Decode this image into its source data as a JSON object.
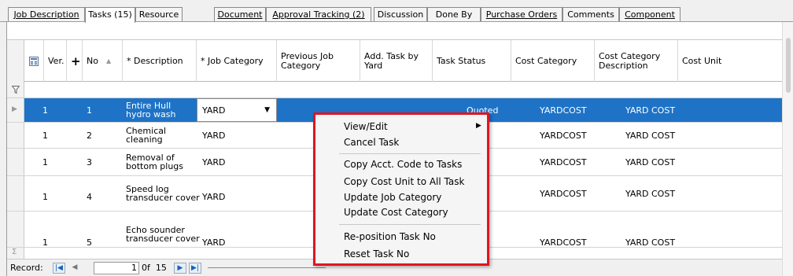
{
  "tabs": [
    {
      "label": "Job Description"
    },
    {
      "label": "Tasks (15)"
    },
    {
      "label": "Resource"
    },
    {
      "label": "Document"
    },
    {
      "label": "Approval Tracking (2)"
    },
    {
      "label": "Discussion"
    },
    {
      "label": "Done By"
    },
    {
      "label": "Purchase Orders"
    },
    {
      "label": "Comments"
    },
    {
      "label": "Component"
    }
  ],
  "grid": {
    "columns": [
      {
        "label": ""
      },
      {
        "label": "Ver."
      },
      {
        "label": "+"
      },
      {
        "label": "No"
      },
      {
        "label": "* Description"
      },
      {
        "label": "* Job Category"
      },
      {
        "label": "Previous Job Category"
      },
      {
        "label": "Add. Task by Yard"
      },
      {
        "label": "Task Status"
      },
      {
        "label": "Cost Category"
      },
      {
        "label": "Cost Category Description"
      },
      {
        "label": "Cost Unit"
      }
    ],
    "sort_icon": "sort-ascending-icon",
    "column_chooser_icon": "column-chooser-icon",
    "filter_icon": "filter-icon",
    "rows": [
      {
        "ver": "1",
        "no": "1",
        "description": "Entire Hull hydro wash",
        "job_category": "YARD",
        "task_status": "Quoted",
        "cost_category": "YARDCOST",
        "cost_category_description": "YARD COST"
      },
      {
        "ver": "1",
        "no": "2",
        "description": "Chemical cleaning",
        "job_category": "YARD",
        "task_status": "",
        "cost_category": "YARDCOST",
        "cost_category_description": "YARD COST"
      },
      {
        "ver": "1",
        "no": "3",
        "description": "Removal of bottom plugs",
        "job_category": "YARD",
        "task_status": "",
        "cost_category": "YARDCOST",
        "cost_category_description": "YARD COST"
      },
      {
        "ver": "1",
        "no": "4",
        "description": "Speed log transducer cover",
        "job_category": "YARD",
        "task_status": "",
        "cost_category": "YARDCOST",
        "cost_category_description": "YARD COST"
      },
      {
        "ver": "1",
        "no": "5",
        "description": "Echo sounder transducer cover",
        "job_category": "YARD",
        "task_status": "",
        "cost_category": "YARDCOST",
        "cost_category_description": "YARD COST"
      }
    ]
  },
  "record_bar": {
    "label": "Record:",
    "current": "1",
    "of_text": "0f  15"
  },
  "context_menu": {
    "items": [
      {
        "label": "View/Edit",
        "submenu": true
      },
      {
        "label": "Cancel Task"
      },
      {
        "label": "Copy Acct. Code to Tasks"
      },
      {
        "label": "Copy Cost Unit to All Task"
      },
      {
        "label": "Update Job Category"
      },
      {
        "label": "Update Cost Category"
      },
      {
        "label": "Re-position Task No"
      },
      {
        "label": "Reset Task No"
      }
    ],
    "highlight_color": "#e3141f"
  },
  "colors": {
    "selection": "#1e73c7",
    "nav_icon": "#1a5fb4"
  }
}
